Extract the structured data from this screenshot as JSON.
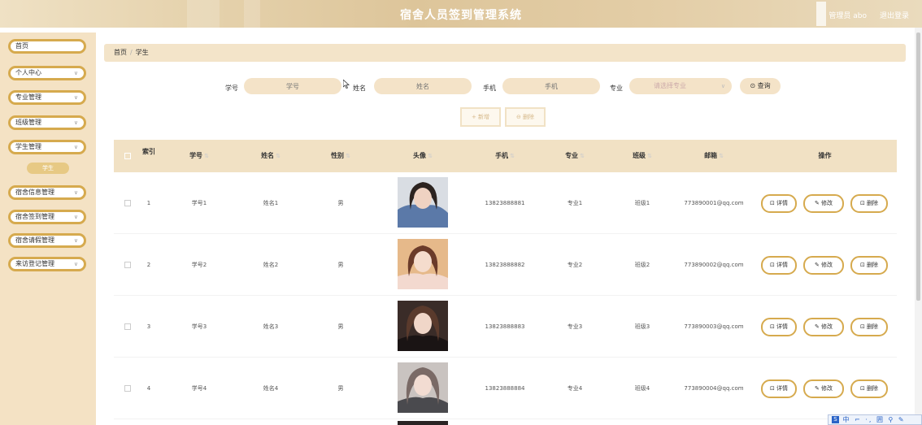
{
  "header": {
    "title": "宿舍人员签到管理系统",
    "user_label": "管理员 abo",
    "logout_label": "退出登录"
  },
  "sidebar": {
    "items": [
      {
        "label": "首页",
        "has_chevron": false
      },
      {
        "label": "个人中心",
        "has_chevron": true
      },
      {
        "label": "专业管理",
        "has_chevron": true
      },
      {
        "label": "班级管理",
        "has_chevron": true
      },
      {
        "label": "学生管理",
        "has_chevron": true
      },
      {
        "label": "宿舍信息管理",
        "has_chevron": true
      },
      {
        "label": "宿舍签到管理",
        "has_chevron": true
      },
      {
        "label": "宿舍请假管理",
        "has_chevron": true
      },
      {
        "label": "来访登记管理",
        "has_chevron": true
      }
    ],
    "active_sub": "学生"
  },
  "breadcrumb": {
    "home": "首页",
    "separator": "/",
    "current": "学生"
  },
  "search": {
    "student_no_label": "学号",
    "student_no_placeholder": "学号",
    "name_label": "姓名",
    "name_placeholder": "姓名",
    "phone_label": "手机",
    "phone_placeholder": "手机",
    "major_label": "专业",
    "major_placeholder": "请选择专业",
    "query_label": "⊙ 查询"
  },
  "actions": {
    "add_label": "+ 新增",
    "delete_label": "⊖ 删除"
  },
  "table": {
    "columns": {
      "index": "索引",
      "student_no": "学号",
      "name": "姓名",
      "gender": "性别",
      "avatar": "头像",
      "phone": "手机",
      "major": "专业",
      "class": "班级",
      "email": "邮箱",
      "operations": "操作"
    },
    "rows": [
      {
        "index": "1",
        "student_no": "学号1",
        "name": "姓名1",
        "gender": "男",
        "phone": "13823888881",
        "major": "专业1",
        "class": "班级1",
        "email": "773890001@qq.com"
      },
      {
        "index": "2",
        "student_no": "学号2",
        "name": "姓名2",
        "gender": "男",
        "phone": "13823888882",
        "major": "专业2",
        "class": "班级2",
        "email": "773890002@qq.com"
      },
      {
        "index": "3",
        "student_no": "学号3",
        "name": "姓名3",
        "gender": "男",
        "phone": "13823888883",
        "major": "专业3",
        "class": "班级3",
        "email": "773890003@qq.com"
      },
      {
        "index": "4",
        "student_no": "学号4",
        "name": "姓名4",
        "gender": "男",
        "phone": "13823888884",
        "major": "专业4",
        "class": "班级4",
        "email": "773890004@qq.com"
      }
    ],
    "op_labels": {
      "detail": "⊡ 详情",
      "edit": "✎ 修改",
      "delete": "⊡ 删除"
    }
  },
  "ime": {
    "text": "中 ⌐ ·, 囲 ⚲ ✎",
    "badge": "S"
  },
  "colors": {
    "accent": "#d6aa4e",
    "header_bg": "#f1e1c4",
    "sidebar_bg": "#f4e2c4"
  }
}
